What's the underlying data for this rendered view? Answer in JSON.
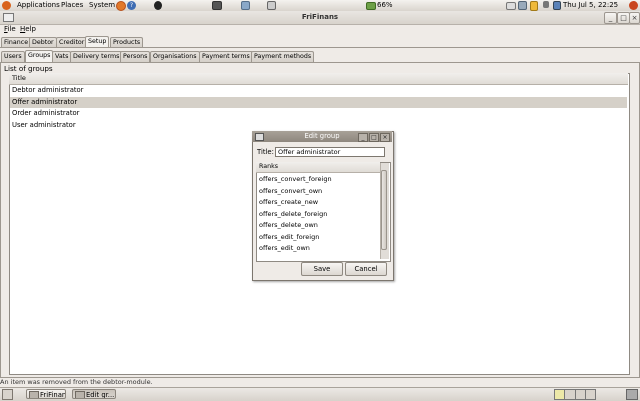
{
  "top_panel": {
    "menus": [
      "Applications",
      "Places",
      "System"
    ],
    "battery": "66%",
    "clock": "Thu Jul  5, 22:25"
  },
  "window": {
    "title": "FriFinans",
    "controls": {
      "minimize": "_",
      "maximize": "□",
      "close": "×"
    }
  },
  "menubar": {
    "file": {
      "underlined": "F",
      "rest": "ile"
    },
    "help": {
      "underlined": "H",
      "rest": "elp"
    }
  },
  "main_tabs": [
    "Finance",
    "Debtor",
    "Creditor",
    "Setup",
    "Products"
  ],
  "main_tabs_active": "Setup",
  "sub_tabs": [
    "Users",
    "Groups",
    "Vats",
    "Delivery terms",
    "Persons",
    "Organisations",
    "Payment terms",
    "Payment methods"
  ],
  "sub_tabs_active": "Groups",
  "groups": {
    "heading": "List of groups",
    "column_title": "Title",
    "rows": [
      "Debtor administrator",
      "Offer administrator",
      "Order administrator",
      "User administrator"
    ],
    "selected": "Offer administrator"
  },
  "dialog": {
    "title": "Edit group",
    "title_label": "Title:",
    "title_value": "Offer administrator",
    "ranks_header": "Ranks",
    "ranks": [
      "offers_convert_foreign",
      "offers_convert_own",
      "offers_create_new",
      "offers_delete_foreign",
      "offers_delete_own",
      "offers_edit_foreign",
      "offers_edit_own"
    ],
    "save_label": "Save",
    "cancel_label": "Cancel"
  },
  "status_message": "An item was removed from the debtor-module.",
  "taskbar": {
    "items": [
      "FriFinans",
      "Edit gr..."
    ]
  },
  "colors": {
    "panel_bg": "#efebe7",
    "selected_row": "#d5d0c8",
    "dialog_titlebar": "#958e85",
    "ubuntu_orange": "#e06c1c"
  }
}
